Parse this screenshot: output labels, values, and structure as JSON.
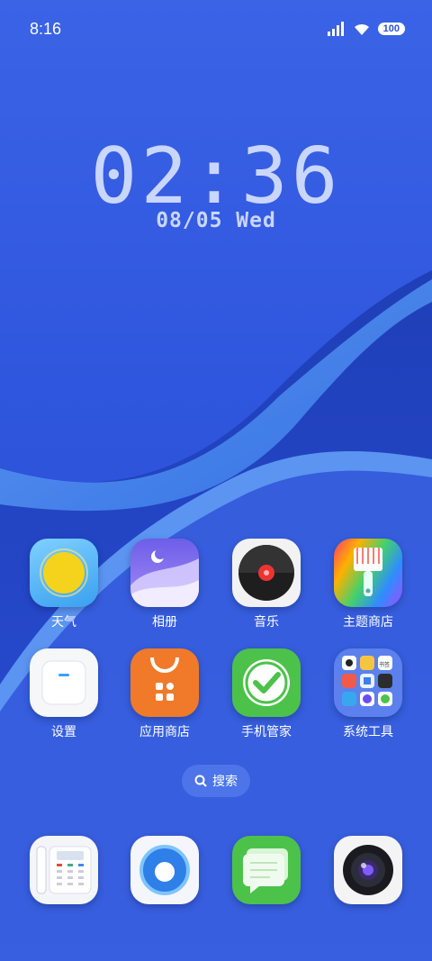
{
  "status_bar": {
    "time": "8:16",
    "battery": "100"
  },
  "lock_clock": {
    "time": "02:36",
    "date": "08/05 Wed"
  },
  "apps": [
    {
      "label": "天气",
      "icon": "weather-sun-icon"
    },
    {
      "label": "相册",
      "icon": "gallery-moon-icon"
    },
    {
      "label": "音乐",
      "icon": "music-record-icon"
    },
    {
      "label": "主题商店",
      "icon": "theme-brush-icon"
    },
    {
      "label": "设置",
      "icon": "settings-switch-icon"
    },
    {
      "label": "应用商店",
      "icon": "app-store-bag-icon"
    },
    {
      "label": "手机管家",
      "icon": "phone-manager-check-icon"
    },
    {
      "label": "系统工具",
      "icon": "system-tools-folder-icon"
    }
  ],
  "folder_mini_labels": [
    "书签"
  ],
  "search": {
    "label": "搜索"
  },
  "dock": [
    {
      "icon": "phone-dialer-icon"
    },
    {
      "icon": "browser-icon"
    },
    {
      "icon": "messages-icon"
    },
    {
      "icon": "camera-icon"
    }
  ],
  "colors": {
    "wallpaper": "#2f56de",
    "accent_green": "#4cc24a",
    "accent_orange": "#f07a2a"
  }
}
